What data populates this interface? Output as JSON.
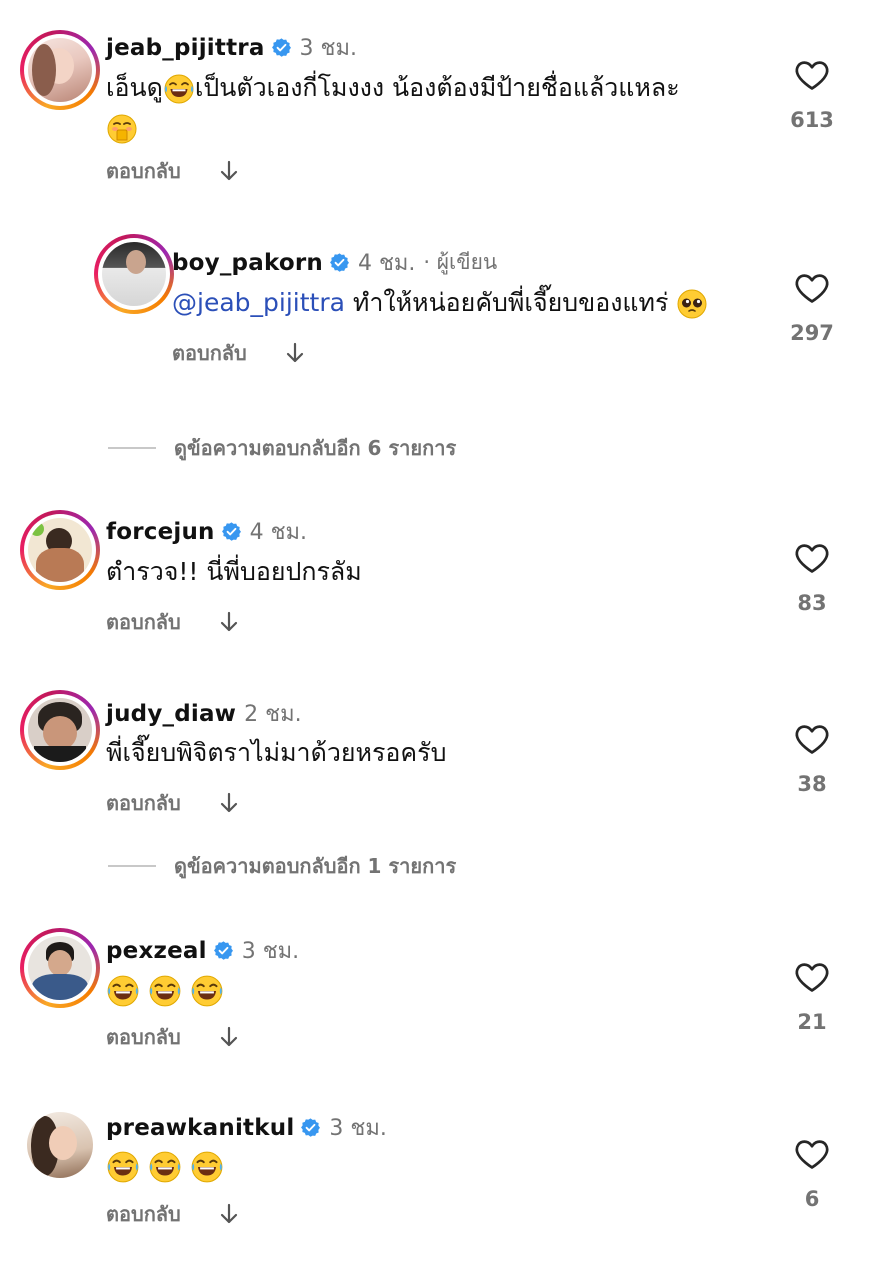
{
  "reply_label": "ตอบกลับ",
  "colors": {
    "verified": "#3897f0",
    "muted": "#737373",
    "mention": "#2b4fb8"
  },
  "comments": [
    {
      "username": "jeab_pijittra",
      "time": "3 ชม.",
      "text_a": "เอ็นดู",
      "text_b": "เป็นตัวเองกี่โมงงง น้องต้องมีป้ายชื่อแล้วแหละ",
      "likes": "613"
    },
    {
      "username": "boy_pakorn",
      "time": "4 ชม.",
      "author_tag": "· ผู้เขียน",
      "mention": "@jeab_pijittra",
      "text": "ทำให้หน่อยคับพี่เจี๊ยบของแทร่",
      "likes": "297"
    },
    {
      "username": "forcejun",
      "time": "4 ชม.",
      "text": "ตำรวจ!! นี่พี่บอยปกรลัม",
      "likes": "83"
    },
    {
      "username": "judy_diaw",
      "time": "2 ชม.",
      "text": "พี่เจี๊ยบพิจิตราไม่มาด้วยหรอครับ",
      "likes": "38"
    },
    {
      "username": "pexzeal",
      "time": "3 ชม.",
      "likes": "21"
    },
    {
      "username": "preawkanitkul",
      "time": "3 ชม.",
      "likes": "6"
    }
  ],
  "view_more": [
    {
      "text": "ดูข้อความตอบกลับอีก 6 รายการ"
    },
    {
      "text": "ดูข้อความตอบกลับอีก 1 รายการ"
    }
  ]
}
